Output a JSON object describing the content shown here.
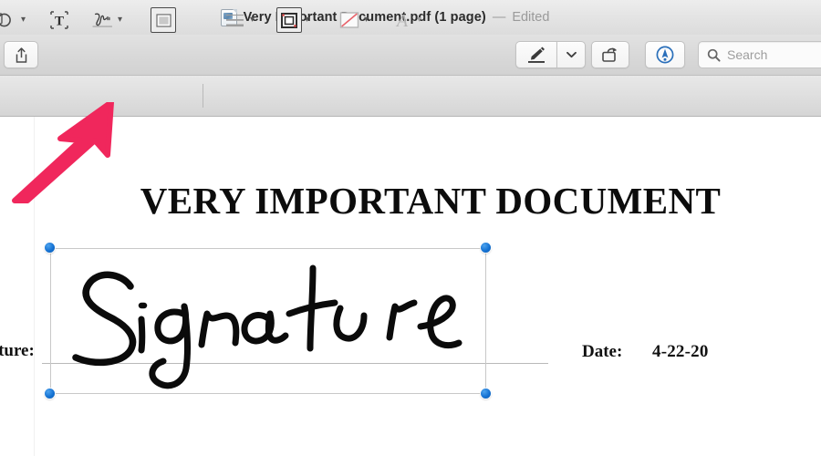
{
  "window": {
    "title": "Very Important Document.pdf (1 page)",
    "dash": "—",
    "edited_status": "Edited",
    "doc_icon": "pdf-document-icon"
  },
  "toolbar": {
    "share_button": {
      "label": "Share",
      "icon": "share-icon"
    },
    "markup_button": {
      "label": "Markup",
      "icon": "markup-pen-icon"
    },
    "markup_menu_button": {
      "label": "Markup options",
      "icon": "chevron-down-icon"
    },
    "rotate_button": {
      "label": "Rotate",
      "icon": "rotate-left-icon"
    },
    "annotate_button": {
      "label": "Annotate",
      "icon": "annotate-circle-icon",
      "active": true,
      "accent_color": "#2a6fba"
    },
    "search": {
      "placeholder": "Search",
      "value": "",
      "icon": "search-icon"
    }
  },
  "markup_bar": {
    "items": [
      {
        "name": "sketch-shapes-tool",
        "label": "Sketch",
        "icon": "shapes-icon",
        "has_menu": true,
        "enabled": true
      },
      {
        "name": "text-tool",
        "label": "Text",
        "icon": "text-box-icon",
        "has_menu": false,
        "enabled": true
      },
      {
        "name": "signature-tool",
        "label": "Sign",
        "icon": "signature-icon",
        "has_menu": true,
        "enabled": true
      },
      {
        "name": "note-tool",
        "label": "Note",
        "icon": "note-box-icon",
        "has_menu": false,
        "enabled": true
      },
      {
        "name": "stroke-style-tool",
        "label": "Shape Style",
        "icon": "line-weight-icon",
        "has_menu": true,
        "enabled": true
      },
      {
        "name": "border-color-tool",
        "label": "Border Color",
        "icon": "border-square-icon",
        "has_menu": true,
        "enabled": true
      },
      {
        "name": "fill-color-tool",
        "label": "Fill Color",
        "icon": "no-fill-icon",
        "has_menu": true,
        "enabled": true
      },
      {
        "name": "font-style-tool",
        "label": "Text Style",
        "icon": "font-a-icon",
        "has_menu": true,
        "enabled": false
      }
    ]
  },
  "document": {
    "title": "VERY IMPORTANT DOCUMENT",
    "signature_label": "nature:",
    "signature_label_full": "Signature:",
    "date_label": "Date:",
    "date_value": "4-22-20",
    "signature_ink_text": "Signature"
  },
  "selection": {
    "object": "signature-annotation",
    "handles": [
      "top-left",
      "top-right",
      "bottom-left",
      "bottom-right"
    ],
    "handle_color": "#1572d3",
    "outline_color": "#C8C8C8"
  },
  "annotation_arrow": {
    "name": "instruction-arrow",
    "color": "#F0275C",
    "points_to": "signature-tool",
    "direction": "up-right"
  }
}
